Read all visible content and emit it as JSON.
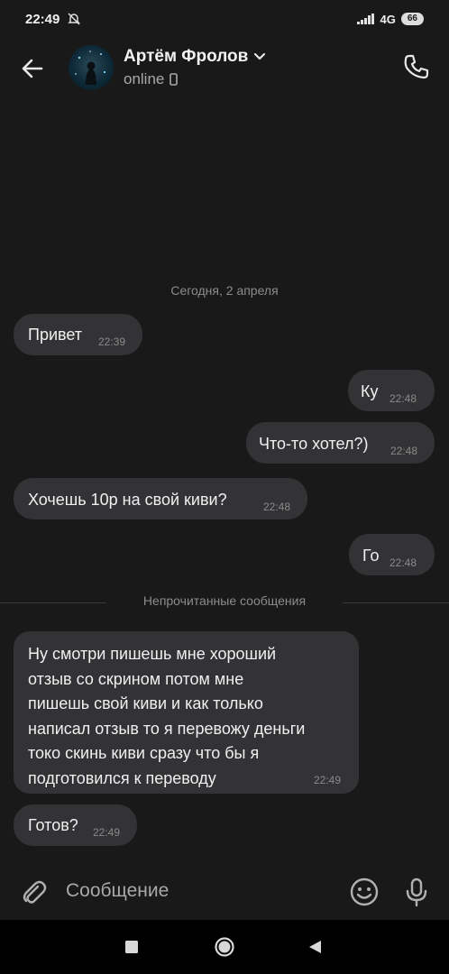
{
  "status_bar": {
    "time": "22:49",
    "network": "4G",
    "battery": "66"
  },
  "header": {
    "contact_name": "Артём Фролов",
    "status": "online",
    "icons": [
      "back-arrow-icon",
      "chevron-down-icon",
      "phone-icon",
      "mobile-device-icon"
    ]
  },
  "chat": {
    "date_separator": "Сегодня, 2 апреля",
    "unread_separator": "Непрочитанные сообщения",
    "messages": [
      {
        "side": "in",
        "text": "Привет",
        "time": "22:39"
      },
      {
        "side": "out",
        "text": "Ку",
        "time": "22:48"
      },
      {
        "side": "out",
        "text": "Что-то хотел?)",
        "time": "22:48"
      },
      {
        "side": "in",
        "text": "Хочешь 10р на свой киви?",
        "time": "22:48"
      },
      {
        "side": "out",
        "text": "Го",
        "time": "22:48"
      },
      {
        "side": "in",
        "lines": [
          "Ну смотри пишешь мне хороший",
          "отзыв со скрином потом мне",
          "пишешь свой киви и как только",
          "написал отзыв то я перевожу деньги",
          "токо скинь киви сразу что бы я",
          "подготовился к переводу"
        ],
        "time": "22:49"
      },
      {
        "side": "in",
        "text": "Готов?",
        "time": "22:49"
      }
    ]
  },
  "composer": {
    "placeholder": "Сообщение",
    "icons": [
      "attach-icon",
      "emoji-icon",
      "microphone-icon"
    ]
  },
  "colors": {
    "background": "#19191a",
    "bubble": "#333336",
    "text": "#f0f0f0",
    "muted": "#8c8c8c"
  }
}
